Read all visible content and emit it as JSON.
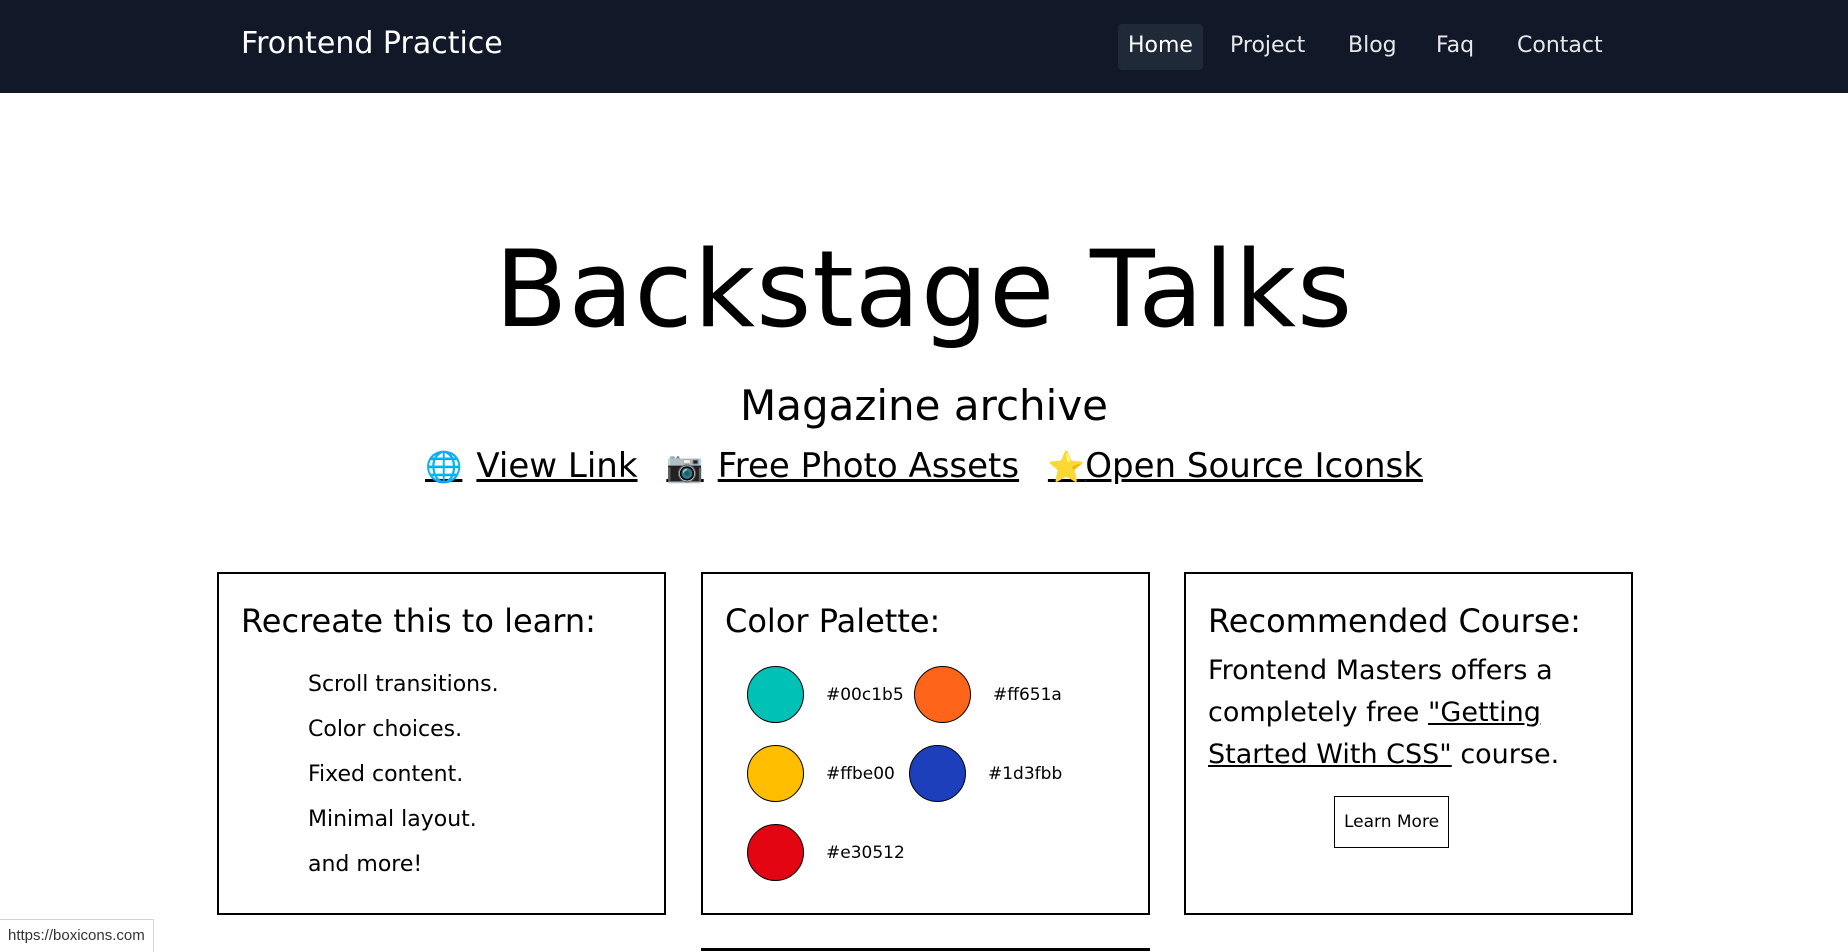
{
  "nav": {
    "brand": "Frontend Practice",
    "links": [
      {
        "label": "Home",
        "active": true
      },
      {
        "label": "Project",
        "active": false
      },
      {
        "label": "Blog",
        "active": false
      },
      {
        "label": "Faq",
        "active": false
      },
      {
        "label": "Contact",
        "active": false
      }
    ]
  },
  "hero": {
    "title": "Backstage Talks",
    "subtitle": "Magazine archive",
    "links": [
      {
        "icon": "globe-icon",
        "glyph": "🌐",
        "label": "View Link"
      },
      {
        "icon": "camera-icon",
        "glyph": "📷",
        "label": "Free Photo Assets"
      },
      {
        "icon": "star-icon",
        "glyph": "⭐",
        "label": "Open Source Iconsk"
      }
    ]
  },
  "cards": {
    "learn": {
      "title": "Recreate this to learn:",
      "items": [
        "Scroll transitions.",
        "Color choices.",
        "Fixed content.",
        "Minimal layout.",
        "and more!"
      ]
    },
    "palette": {
      "title": "Color Palette:",
      "colors": [
        "#00c1b5",
        "#ff651a",
        "#ffbe00",
        "#1d3fbb",
        "#e30512"
      ]
    },
    "course": {
      "title": "Recommended Course:",
      "text_before": "Frontend Masters offers a completely free ",
      "link": "\"Getting Started With CSS\"",
      "text_after": " course.",
      "button": "Learn More"
    }
  },
  "status": {
    "url": "https://boxicons.com"
  }
}
